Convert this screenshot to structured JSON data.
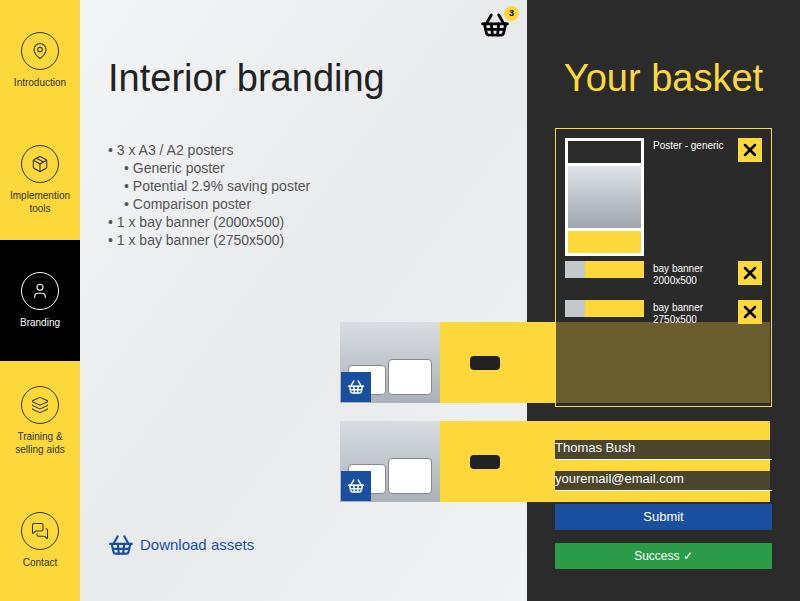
{
  "sidebar": {
    "items": [
      {
        "label": "Introduction",
        "selected": false,
        "icon": "pin"
      },
      {
        "label": "Implemention tools",
        "selected": false,
        "icon": "tools"
      },
      {
        "label": "Branding",
        "selected": true,
        "icon": "person"
      },
      {
        "label": "Training & selling aids",
        "selected": false,
        "icon": "layers"
      },
      {
        "label": "Contact",
        "selected": false,
        "icon": "chat"
      }
    ]
  },
  "page": {
    "title": "Interior branding",
    "bullet": "•",
    "items": [
      {
        "text": "3 x A3 / A2 posters",
        "level": 0
      },
      {
        "text": "Generic poster",
        "level": 1
      },
      {
        "text": "Potential 2.9% saving poster",
        "level": 1
      },
      {
        "text": "Comparison poster",
        "level": 1
      },
      {
        "text": "1 x bay banner (2000x500)",
        "level": 0
      },
      {
        "text": "1 x bay banner (2750x500)",
        "level": 0
      }
    ],
    "download": "Download assets",
    "basket_count": "3"
  },
  "basket": {
    "title": "Your basket",
    "items": [
      {
        "lines": [
          "Poster - generic"
        ],
        "kind": "poster"
      },
      {
        "lines": [
          "bay banner",
          "2000x500"
        ],
        "kind": "banner"
      },
      {
        "lines": [
          "bay banner",
          "2750x500"
        ],
        "kind": "banner"
      }
    ]
  },
  "form": {
    "name": "Thomas Bush",
    "email": "youremail@email.com",
    "submit": "Submit",
    "success": "Success ✓"
  }
}
